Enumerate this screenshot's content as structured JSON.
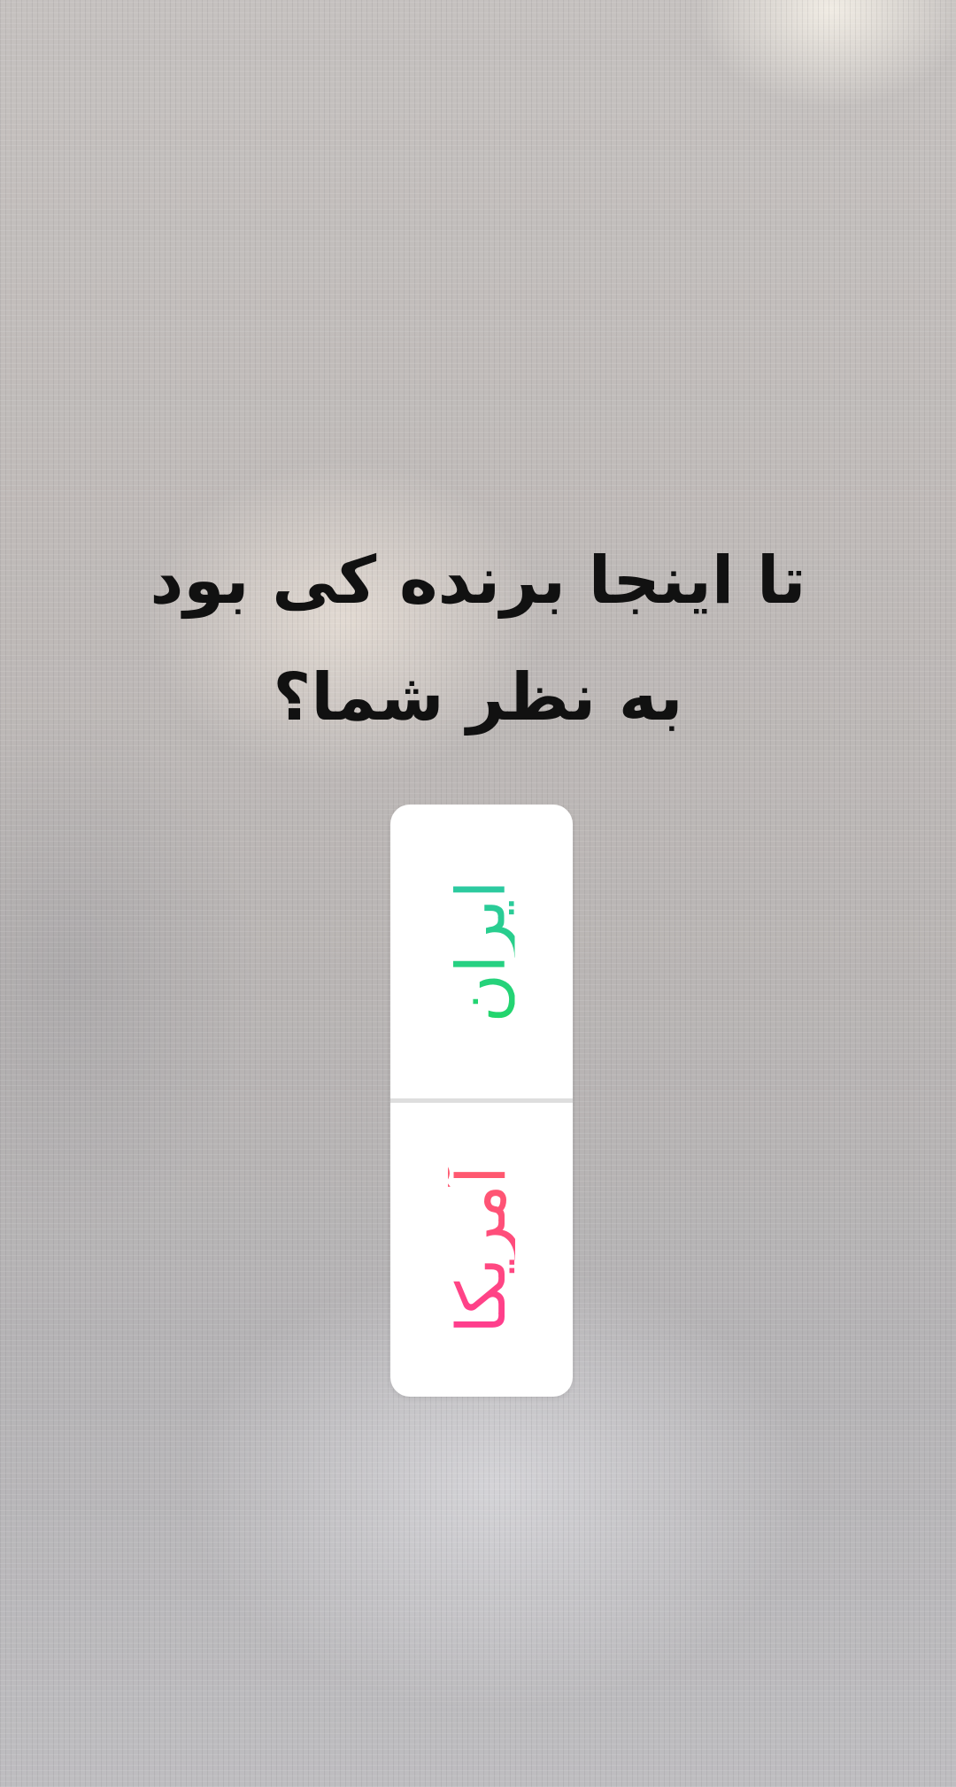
{
  "story": {
    "question_line1": "تا اینجا برنده کی بود",
    "question_line2": "به نظر شما؟"
  },
  "poll": {
    "options": [
      {
        "label": "ایران",
        "gradient": [
          "#22d66a",
          "#2cc9a3"
        ]
      },
      {
        "label": "آمریکا",
        "gradient": [
          "#ff3c8e",
          "#ff5a6e"
        ]
      }
    ]
  }
}
